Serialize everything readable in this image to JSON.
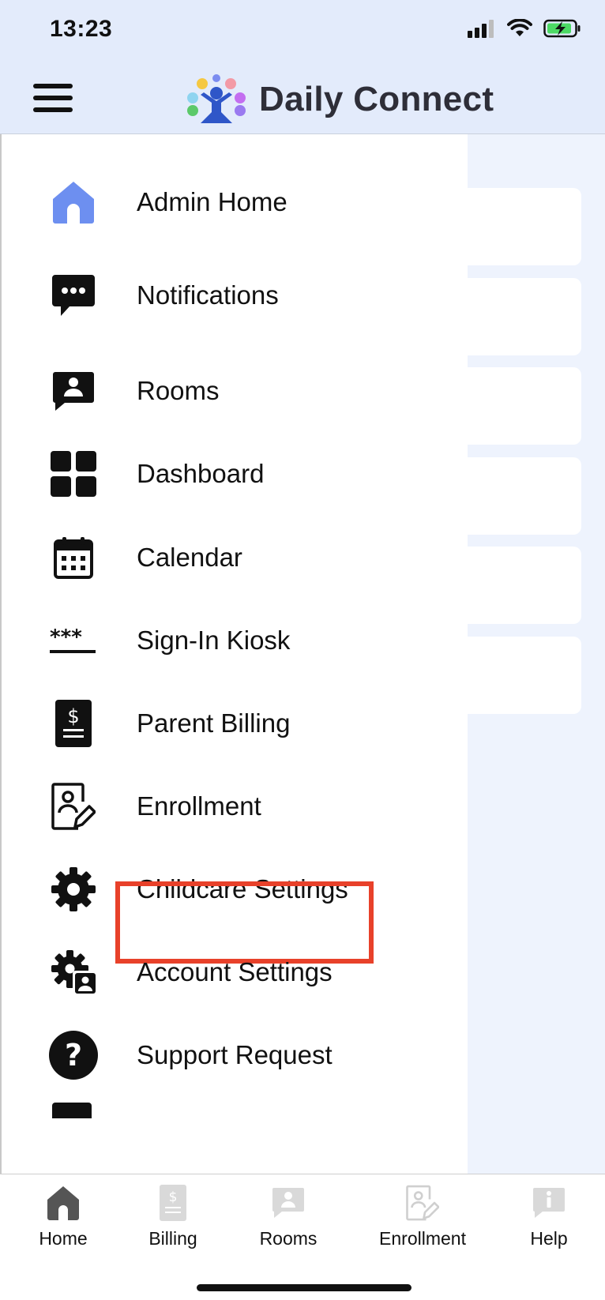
{
  "status_bar": {
    "time": "13:23"
  },
  "header": {
    "app_title": "Daily Connect"
  },
  "menu": {
    "items": [
      {
        "label": "Admin Home",
        "icon": "home-icon"
      },
      {
        "label": "Notifications",
        "icon": "message-dots-icon"
      },
      {
        "label": "Rooms",
        "icon": "room-person-icon"
      },
      {
        "label": "Dashboard",
        "icon": "grid-icon"
      },
      {
        "label": "Calendar",
        "icon": "calendar-icon"
      },
      {
        "label": "Sign-In Kiosk",
        "icon": "password-icon"
      },
      {
        "label": "Parent Billing",
        "icon": "bill-icon"
      },
      {
        "label": "Enrollment",
        "icon": "enrollment-form-icon"
      },
      {
        "label": "Childcare Settings",
        "icon": "gear-icon",
        "highlighted": true
      },
      {
        "label": "Account Settings",
        "icon": "gear-person-icon"
      },
      {
        "label": "Support Request",
        "icon": "question-icon"
      }
    ]
  },
  "tabbar": {
    "tabs": [
      {
        "label": "Home",
        "icon": "home-icon",
        "active": true
      },
      {
        "label": "Billing",
        "icon": "bill-icon",
        "active": false
      },
      {
        "label": "Rooms",
        "icon": "room-person-icon",
        "active": false
      },
      {
        "label": "Enrollment",
        "icon": "enrollment-form-icon",
        "active": false
      },
      {
        "label": "Help",
        "icon": "info-icon",
        "active": false
      }
    ]
  },
  "colors": {
    "header_bg": "#e3ebfb",
    "active_home_icon": "#6d8ff0",
    "highlight_border": "#e8412a",
    "inactive_tab_icon": "#d9d9d9"
  }
}
